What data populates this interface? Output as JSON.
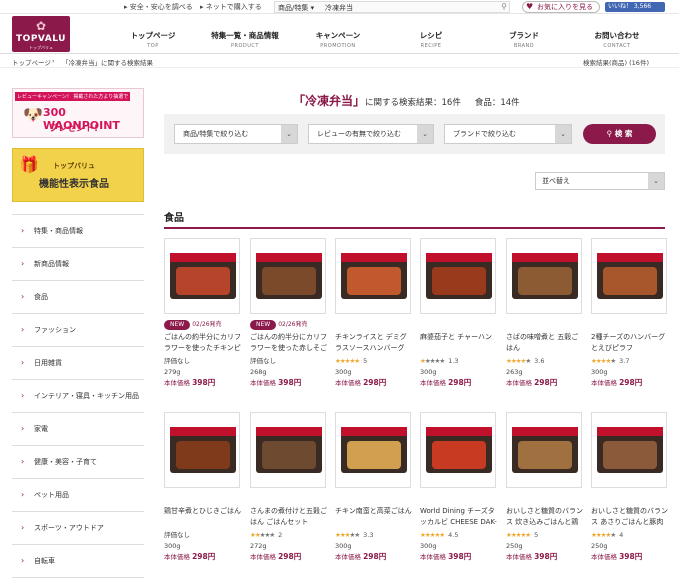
{
  "topbar": {
    "links": [
      "安全・安心を調べる",
      "ネットで購入する"
    ],
    "search_category": "商品/特集",
    "search_value": "冷凍弁当",
    "favorite": "お気に入りを見る",
    "like": "いいね！ 3,566"
  },
  "logo": {
    "text": "TOPVALU",
    "sub": "トップバリュ"
  },
  "nav": [
    {
      "jp": "トップページ",
      "en": "TOP"
    },
    {
      "jp": "特集一覧・商品情報",
      "en": "PRODUCT"
    },
    {
      "jp": "キャンペーン",
      "en": "PROMOTION"
    },
    {
      "jp": "レシピ",
      "en": "RECIPE"
    },
    {
      "jp": "ブランド",
      "en": "BRAND"
    },
    {
      "jp": "お問い合わせ",
      "en": "CONTACT"
    }
  ],
  "breadcrumb": {
    "home": "トップページ",
    "current": "「冷凍弁当」に関する検索結果",
    "right": "検索結果(商品) (16件)"
  },
  "banner1": {
    "tag": "レビューキャンペーン！ 掲載された方より抽選で",
    "points": "300 WAONPOINT",
    "gift": "プレゼント!"
  },
  "banner2": {
    "line1": "トップバリュ",
    "line2": "機能性表示食品"
  },
  "menu": [
    "特集・商品情報",
    "新商品情報",
    "食品",
    "ファッション",
    "日用雑貨",
    "インテリア・寝具・キッチン用品",
    "家電",
    "健康・美容・子育て",
    "ペット用品",
    "スポーツ・アウトドア",
    "自転車"
  ],
  "headline": {
    "keyword": "「冷凍弁当」",
    "rest": "に関する検索結果：16件",
    "count": "食品：14件"
  },
  "filters": {
    "f1": "商品/特集で絞り込む",
    "f2": "レビューの有無で絞り込む",
    "f3": "ブランドで絞り込む",
    "search": "検 索"
  },
  "sort": "並べ替え",
  "section": "食品",
  "products": [
    {
      "new": "NEW",
      "date": "02/26発売",
      "name": "ごはんの約半分にカリフラワーを使ったチキンピラ…",
      "rating": "評価なし",
      "stars": 0,
      "count": "",
      "weight": "279g",
      "price_label": "本体価格",
      "price": "398円",
      "food": "#b5442a"
    },
    {
      "new": "NEW",
      "date": "02/26発売",
      "name": "ごはんの約半分にカリフラワーを使った赤しそごは…",
      "rating": "評価なし",
      "stars": 0,
      "count": "",
      "weight": "268g",
      "price_label": "本体価格",
      "price": "398円",
      "food": "#7a4a2a"
    },
    {
      "new": "",
      "date": "",
      "name": "チキンライスと デミグラスソースハンバーグ",
      "rating": "",
      "stars": 5,
      "count": "5",
      "weight": "300g",
      "price_label": "本体価格",
      "price": "298円",
      "food": "#c2582e"
    },
    {
      "new": "",
      "date": "",
      "name": "麻婆茄子と チャーハン",
      "rating": "",
      "stars": 1,
      "count": "1.3",
      "weight": "300g",
      "price_label": "本体価格",
      "price": "298円",
      "food": "#9a3a1c"
    },
    {
      "new": "",
      "date": "",
      "name": "さばの味噌煮と 五穀ごはん",
      "rating": "",
      "stars": 4,
      "count": "3.6",
      "weight": "263g",
      "price_label": "本体価格",
      "price": "298円",
      "food": "#8c5b34"
    },
    {
      "new": "",
      "date": "",
      "name": "2種チーズのハンバーグとえびピラフ",
      "rating": "",
      "stars": 4,
      "count": "3.7",
      "weight": "300g",
      "price_label": "本体価格",
      "price": "298円",
      "food": "#a8562c"
    },
    {
      "new": "",
      "date": "",
      "name": "鶏甘辛煮とひじきごはん",
      "rating": "評価なし",
      "stars": 0,
      "count": "",
      "weight": "300g",
      "price_label": "本体価格",
      "price": "298円",
      "food": "#7e3a1a"
    },
    {
      "new": "",
      "date": "",
      "name": "さんまの煮付けと五穀ごはん ごはんセット",
      "rating": "",
      "stars": 2,
      "count": "2",
      "weight": "272g",
      "price_label": "本体価格",
      "price": "298円",
      "food": "#6e4a30"
    },
    {
      "new": "",
      "date": "",
      "name": "チキン南蛮と高菜ごはん",
      "rating": "",
      "stars": 3,
      "count": "3.3",
      "weight": "300g",
      "price_label": "本体価格",
      "price": "298円",
      "food": "#d0a050"
    },
    {
      "new": "",
      "date": "",
      "name": "World Dining チーズタッカルビ CHEESE DAK-GALBI",
      "rating": "",
      "stars": 5,
      "count": "4.5",
      "weight": "300g",
      "price_label": "本体価格",
      "price": "398円",
      "food": "#c83a22"
    },
    {
      "new": "",
      "date": "",
      "name": "おいしさと糖質のバランス 炊き込みごはんと鶏肉の…",
      "rating": "",
      "stars": 5,
      "count": "5",
      "weight": "250g",
      "price_label": "本体価格",
      "price": "398円",
      "food": "#a07040"
    },
    {
      "new": "",
      "date": "",
      "name": "おいしさと糖質のバランス あさりごはんと豚肉の味…",
      "rating": "",
      "stars": 4,
      "count": "4",
      "weight": "250g",
      "price_label": "本体価格",
      "price": "398円",
      "food": "#8a5a3a"
    }
  ],
  "colors": {
    "brand": "#8b1a4a",
    "star": "#f0a830"
  }
}
